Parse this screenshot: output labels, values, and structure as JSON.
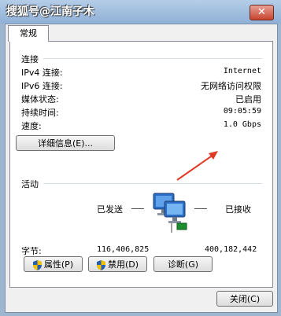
{
  "window": {
    "watermark": "搜狐号@江南子木",
    "close_symbol": "✕"
  },
  "tab": {
    "label": "常规"
  },
  "connection": {
    "group_label": "连接",
    "rows": [
      {
        "label": "IPv4 连接:",
        "value": "Internet"
      },
      {
        "label": "IPv6 连接:",
        "value": "无网络访问权限"
      },
      {
        "label": "媒体状态:",
        "value": "已启用"
      },
      {
        "label": "持续时间:",
        "value": "09:05:59"
      },
      {
        "label": "速度:",
        "value": "1.0 Gbps"
      }
    ],
    "details_button": "详细信息(E)..."
  },
  "activity": {
    "group_label": "活动",
    "sent_label": "已发送",
    "received_label": "已接收",
    "bytes_label": "字节:",
    "bytes_sent": "116,406,825",
    "bytes_received": "400,182,442"
  },
  "buttons": {
    "properties": "属性(P)",
    "disable": "禁用(D)",
    "diagnose": "诊断(G)",
    "close": "关闭(C)"
  },
  "colors": {
    "arrow": "#e03a24",
    "shield_blue": "#2a5db0",
    "shield_yellow": "#f2c200"
  }
}
